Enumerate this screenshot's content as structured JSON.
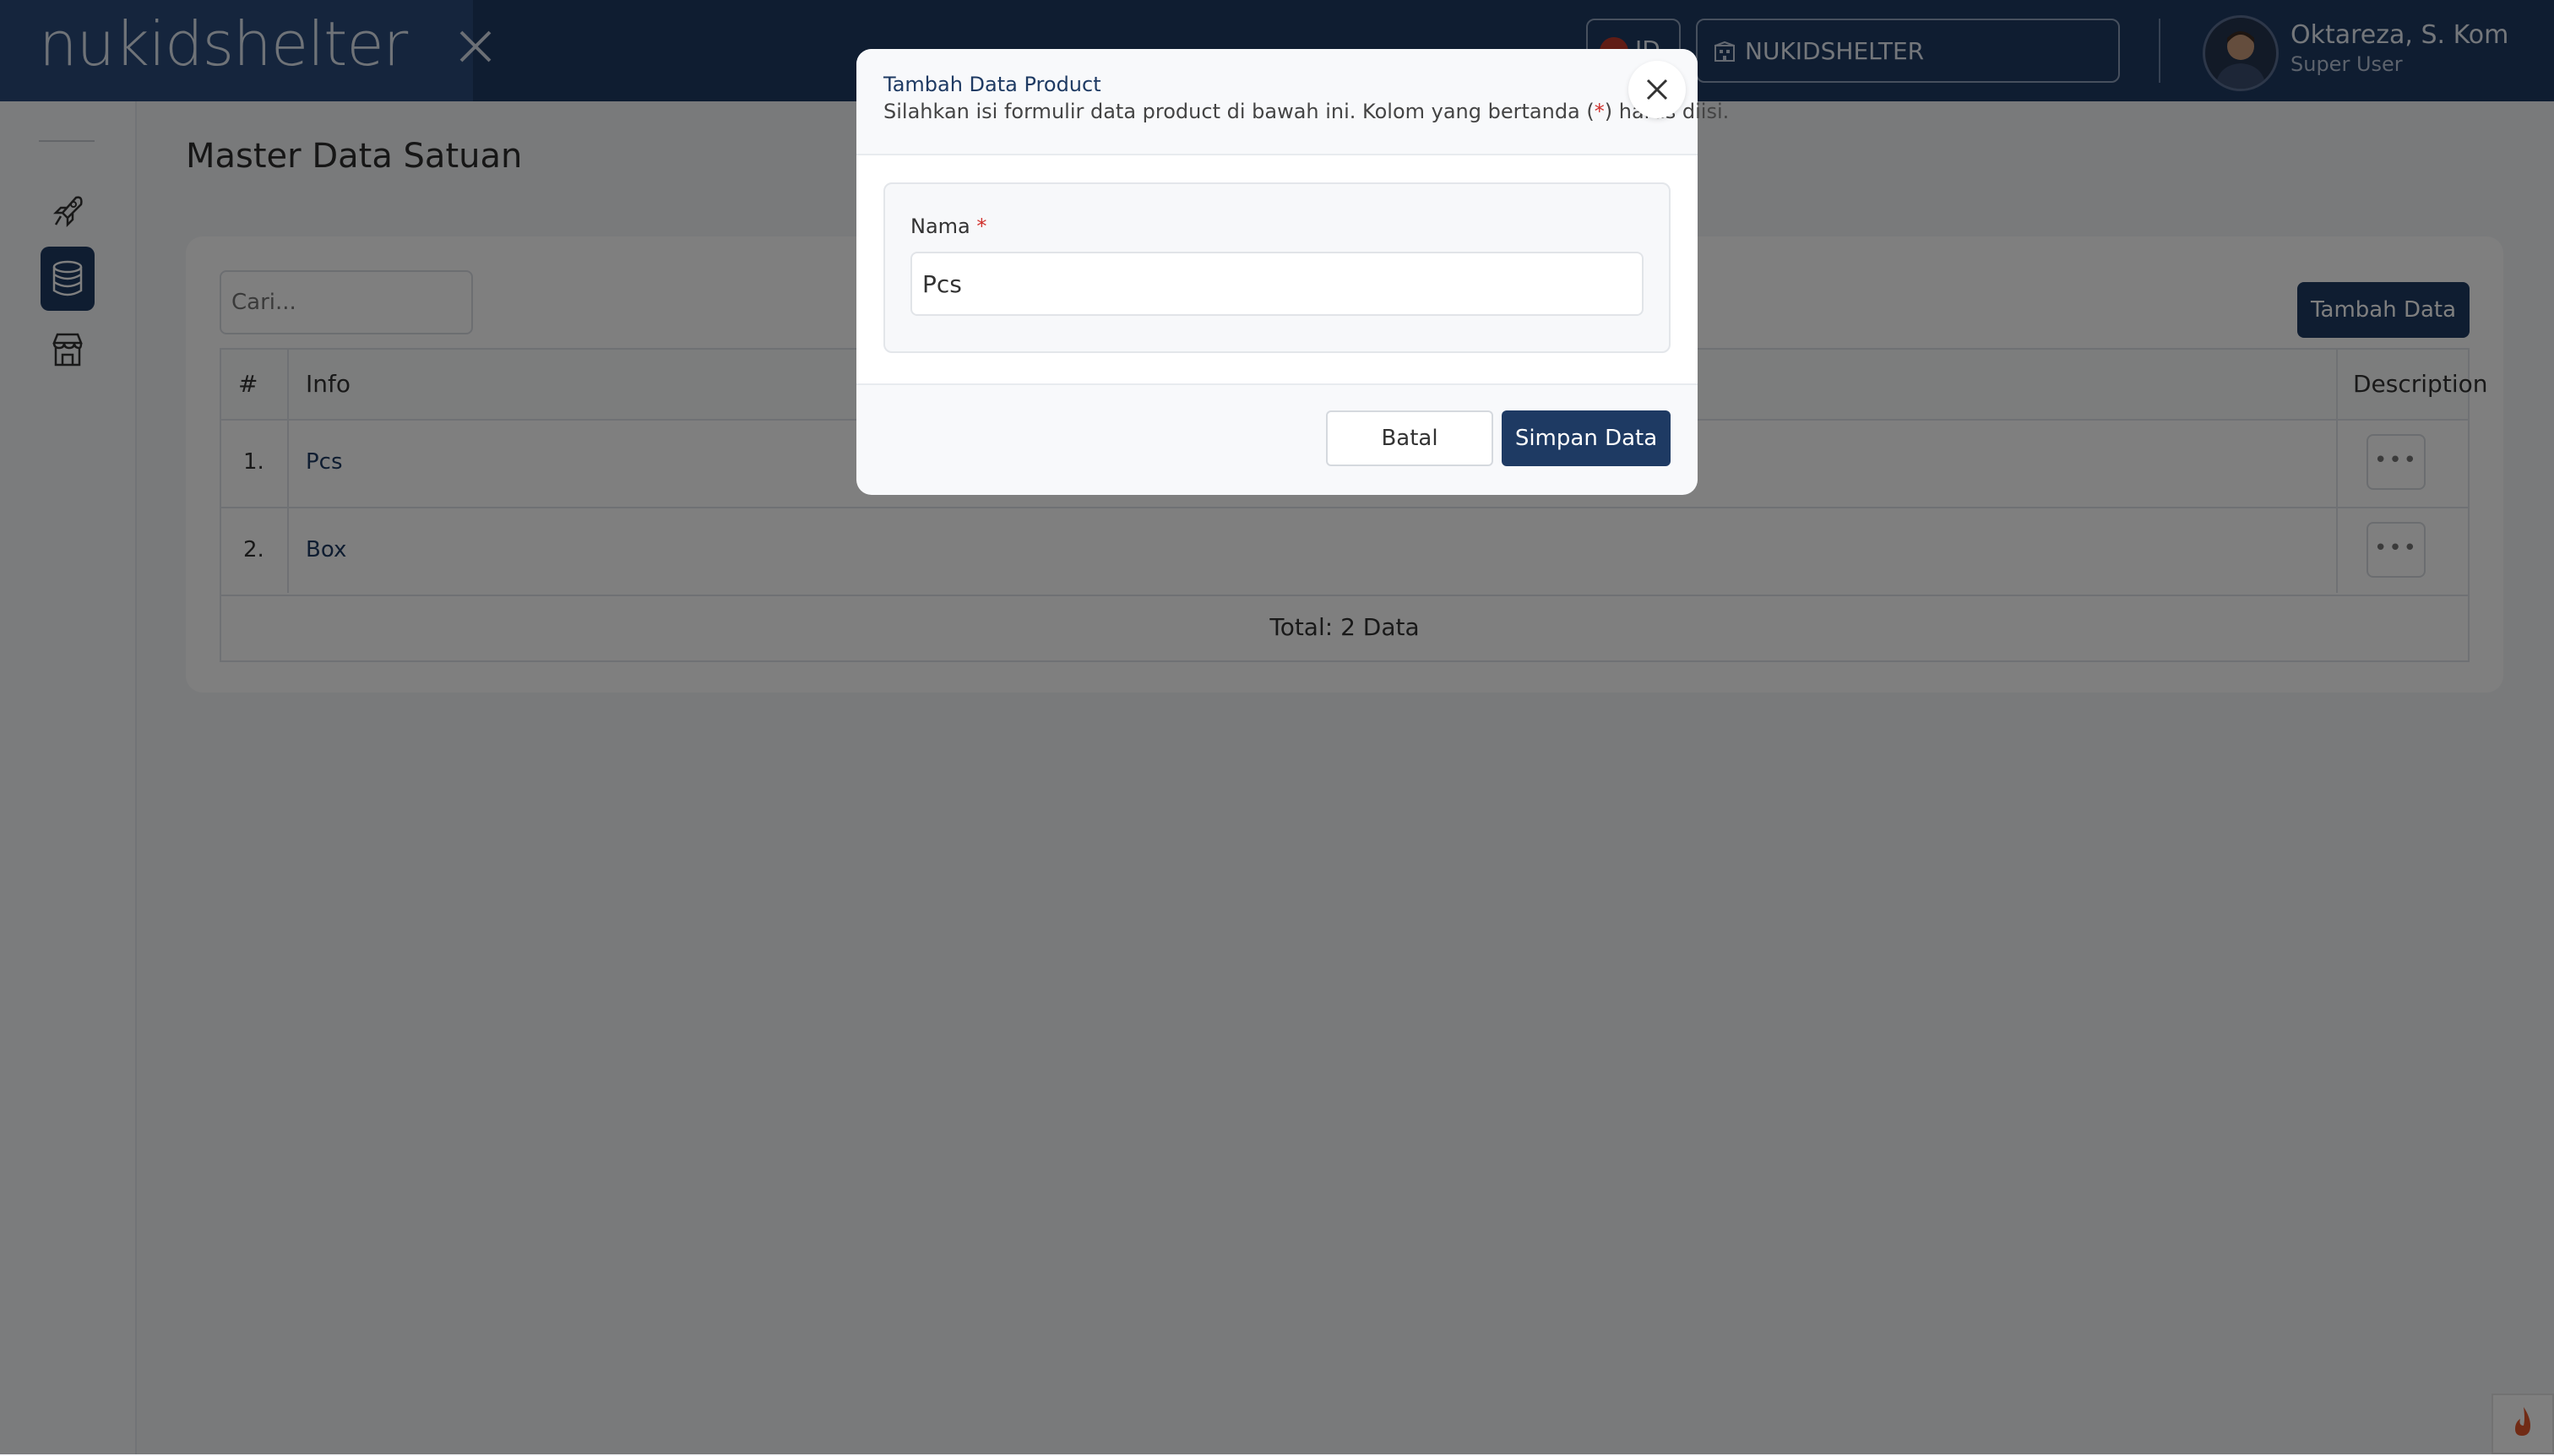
{
  "app": {
    "logo_text": "nukidshelter"
  },
  "header": {
    "lang_label": "ID",
    "company_name": "NUKIDSHELTER",
    "user_name": "Oktareza, S. Kom",
    "user_role": "Super User"
  },
  "sidebar": {
    "items": [
      {
        "icon": "rocket-icon"
      },
      {
        "icon": "database-icon",
        "active": true
      },
      {
        "icon": "store-icon"
      }
    ]
  },
  "page": {
    "title": "Master Data Satuan",
    "search_placeholder": "Cari...",
    "add_button": "Tambah Data",
    "table": {
      "headers": [
        "#",
        "Info",
        "Description"
      ],
      "rows": [
        {
          "no": "1.",
          "info": "Pcs"
        },
        {
          "no": "2.",
          "info": "Box"
        }
      ],
      "actions_label": "•••",
      "total": "Total: 2 Data"
    }
  },
  "modal": {
    "title": "Tambah Data Product",
    "subtitle_before": "Silahkan isi formulir data product di bawah ini. Kolom yang bertanda (",
    "subtitle_star": "*",
    "subtitle_after": ") harus diisi.",
    "field_label": "Nama",
    "field_required": "*",
    "field_value": "Pcs",
    "cancel_button": "Batal",
    "save_button": "Simpan Data"
  },
  "colors": {
    "primary": "#1e3a63",
    "required": "#d0312d"
  }
}
